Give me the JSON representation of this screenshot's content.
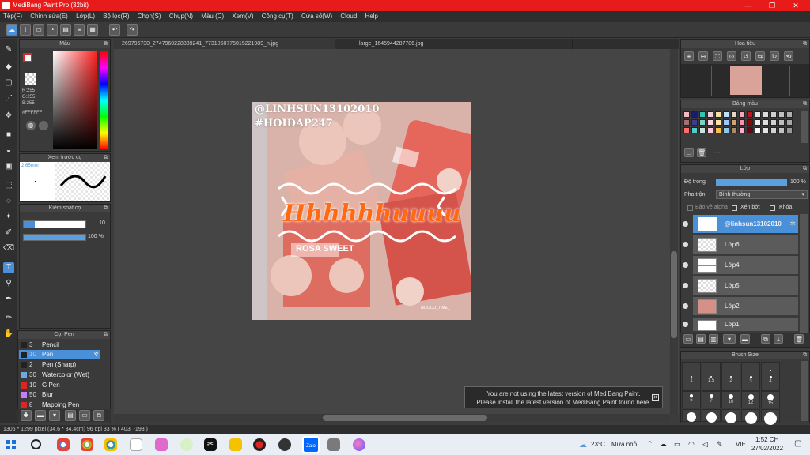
{
  "window": {
    "title": "MediBang Paint Pro (32bit)",
    "controls": {
      "minimize": "—",
      "maximize": "❐",
      "close": "✕"
    }
  },
  "menu": [
    "Tệp(F)",
    "Chỉnh sửa(E)",
    "Lớp(L)",
    "Bộ lọc(R)",
    "Chọn(S)",
    "Chụp(N)",
    "Màu (C)",
    "Xem(V)",
    "Công cụ(T)",
    "Cửa sổ(W)",
    "Cloud",
    "Help"
  ],
  "tabs": [
    "269796730_2747960228839241_7731050775015221989_n.jpg",
    "large_1645944287786.jpg"
  ],
  "color_panel": {
    "title": "Màu",
    "r": "R:255",
    "g": "G:255",
    "b": "B:255",
    "hex": "#FFFFFF"
  },
  "brush_preview": {
    "title": "Xem trước cọ",
    "size": "2.65mm"
  },
  "brush_control": {
    "title": "Kiểm soát cọ",
    "size_value": "10",
    "opacity_value": "100 %"
  },
  "pen_panel": {
    "title": "Cọ: Pen",
    "items": [
      {
        "size": "3",
        "name": "Pencil",
        "color": "#222222"
      },
      {
        "size": "10",
        "name": "Pen",
        "color": "#222222",
        "selected": true
      },
      {
        "size": "2",
        "name": "Pen (Sharp)",
        "color": "#222222"
      },
      {
        "size": "30",
        "name": "Watercolor (Wet)",
        "color": "#6fa8dc"
      },
      {
        "size": "10",
        "name": "G Pen",
        "color": "#e02424"
      },
      {
        "size": "50",
        "name": "Blur",
        "color": "#c77dff"
      },
      {
        "size": "8",
        "name": "Mapping Pen",
        "color": "#e02424"
      }
    ]
  },
  "navigator": {
    "title": "Hoa tiêu"
  },
  "palette": {
    "title": "Bảng màu",
    "more": "---",
    "colors": [
      "#f4b6c2",
      "#1a1a6e",
      "#2ec4b6",
      "#f1d0d8",
      "#f7e1a0",
      "#bde0fe",
      "#e8d5c4",
      "#f4a7b9",
      "#c1121f",
      "#eaeaea",
      "#dddddd",
      "#cfcfcf",
      "#c0c0c0",
      "#b0b0b0",
      "#a66f6f",
      "#3d3d8c",
      "#7dd3c0",
      "#ffd6e0",
      "#ffe5a0",
      "#a0c4ff",
      "#d4a373",
      "#ff8fab",
      "#8d0801",
      "#f0f0f0",
      "#e0e0e0",
      "#d0d0d0",
      "#bfbfbf",
      "#a8a8a8",
      "#ff6b6b",
      "#4ecdc4",
      "#c9e4de",
      "#ffc8dd",
      "#fcbf49",
      "#8ecae6",
      "#b08968",
      "#ffafcc",
      "#6a040f",
      "#fafafa",
      "#e5e5e5",
      "#d4d4d4",
      "#c4c4c4",
      "#999999"
    ]
  },
  "layers": {
    "title": "Lớp",
    "opacity_label": "Độ trong",
    "opacity_value": "100 %",
    "blend_label": "Pha trộn",
    "blend_value": "Bình thường",
    "protect_alpha": "Bảo vệ alpha",
    "clipping": "Xén bớt",
    "lock": "Khóa",
    "items": [
      {
        "name": "@linhsun13102010",
        "selected": true
      },
      {
        "name": "Lớp6"
      },
      {
        "name": "Lớp4"
      },
      {
        "name": "Lớp5"
      },
      {
        "name": "Lớp2"
      },
      {
        "name": "Lớp1"
      }
    ]
  },
  "brush_size": {
    "title": "Brush Size",
    "rows": [
      [
        "1",
        "1.5",
        "2",
        "3",
        "4"
      ],
      [
        "5",
        "7",
        "10",
        "12",
        "15"
      ]
    ]
  },
  "artwork": {
    "handle1": "@LINHSUN13102010",
    "handle2": "#HOIDAP247",
    "center": "Hhhhhhuuuu",
    "small": "ROSA SWEET",
    "bottom": "NOLICO_TIME_"
  },
  "notice": {
    "line1": "You are not using the latest version of MediBang Paint.",
    "line2": "Please install the latest version of MediBang Paint found here."
  },
  "status": {
    "text": "1306 * 1299 pixel  (34.6 * 34.4cm)  96 dpi  33 %  ( 403, -193 )"
  },
  "taskbar": {
    "temp": "23°C",
    "weather": "Mưa nhỏ",
    "lang": "VIE",
    "time": "1:52 CH",
    "date": "27/02/2022"
  }
}
